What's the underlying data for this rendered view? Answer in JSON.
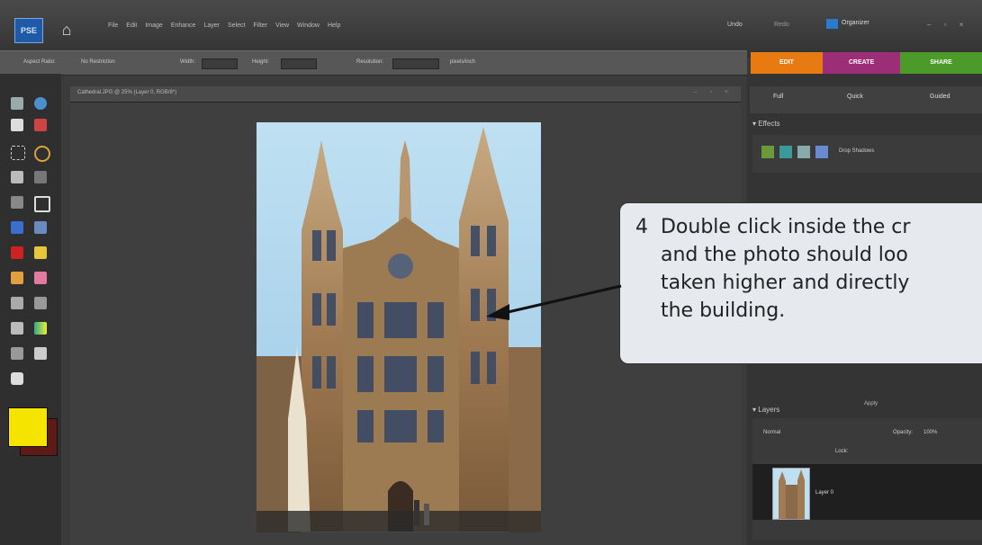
{
  "app": {
    "logo_text": "PSE",
    "menu": [
      "File",
      "Edit",
      "Image",
      "Enhance",
      "Layer",
      "Select",
      "Filter",
      "View",
      "Window",
      "Help"
    ],
    "undo_label": "Undo",
    "redo_label": "Redo",
    "organizer_label": "Organizer",
    "window_controls": "– ▫ ×"
  },
  "options_bar": {
    "aspect_label": "Aspect Ratio:",
    "aspect_value": "No Restriction",
    "width_label": "Width:",
    "height_label": "Height:",
    "resolution_label": "Resolution:",
    "units_value": "pixels/inch"
  },
  "mode_tabs": [
    {
      "label": "EDIT",
      "color": "#e87a12"
    },
    {
      "label": "CREATE",
      "color": "#9c2d77"
    },
    {
      "label": "SHARE",
      "color": "#4b9a2a"
    }
  ],
  "document": {
    "title": "Cathedral.JPG @ 25% (Layer 0, RGB/8*)",
    "controls": "– ▫ ×"
  },
  "panel": {
    "edit_modes": [
      "Full",
      "Quick",
      "Guided"
    ],
    "effects_title": "Effects",
    "effects_dropdown": "Drop Shadows",
    "apply_label": "Apply",
    "layers_title": "Layers",
    "blend_mode": "Normal",
    "opacity_label": "Opacity:",
    "opacity_value": "100%",
    "lock_label": "Lock:",
    "layer_name": "Layer 0"
  },
  "colors": {
    "foreground": "#f5e300",
    "background": "#5d1a16"
  },
  "callout": {
    "text": "4  Double click inside the cr\n    and the photo should loo\n    taken higher and directly\n    the building."
  }
}
